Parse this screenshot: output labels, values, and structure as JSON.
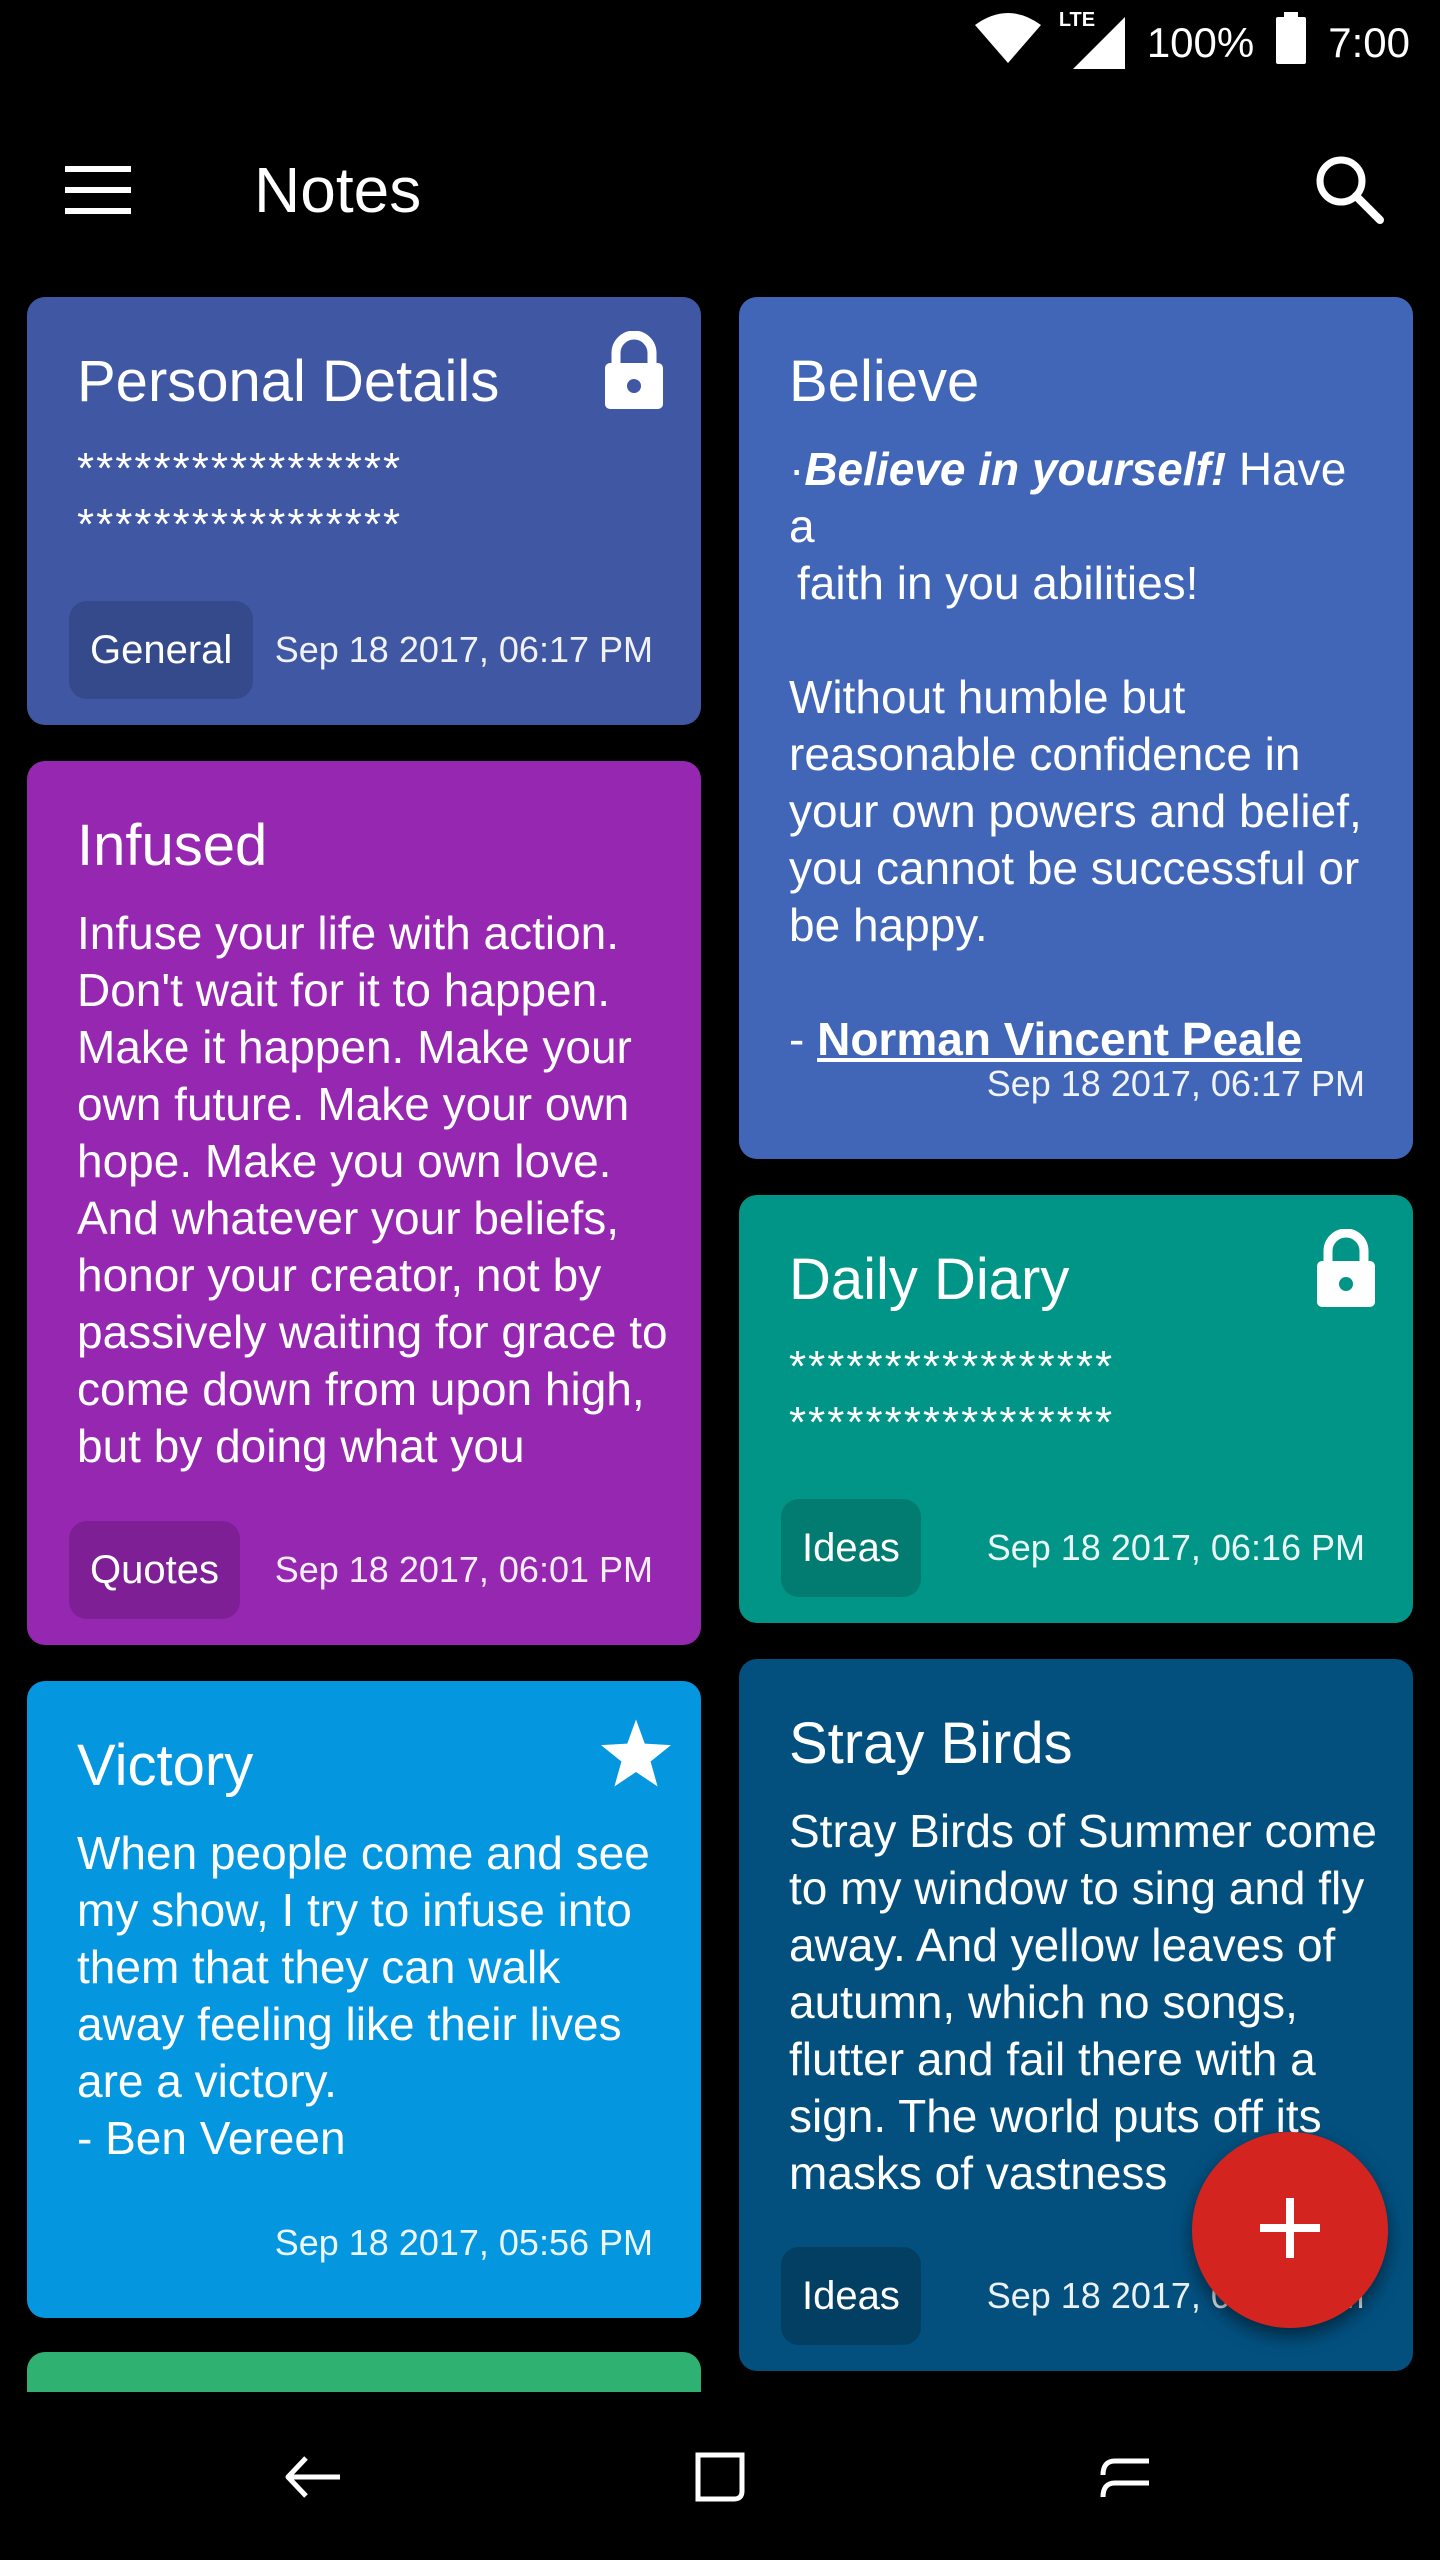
{
  "status_bar": {
    "network": "LTE",
    "battery": "100%",
    "time": "7:00"
  },
  "app_bar": {
    "title": "Notes",
    "menu_icon": "hamburger-menu-icon",
    "search_icon": "search-icon"
  },
  "notes": [
    {
      "title": "Personal Details",
      "body_masked": [
        "*****************",
        "*****************"
      ],
      "chip": "General",
      "timestamp": "Sep 18 2017, 06:17 PM",
      "icon": "lock-icon",
      "color": "#4058A4",
      "chip_color": "#344A8B"
    },
    {
      "title": "Infused",
      "body": "Infuse your life with action. Don't wait for it to happen. Make it happen. Make your own future. Make your own hope. Make you own love. And whatever your beliefs, honor your creator, not by passively waiting for grace to come down from upon high, but by doing what you",
      "chip": "Quotes",
      "timestamp": "Sep 18 2017, 06:01 PM",
      "color": "#9527B0",
      "chip_color": "#7E1F96"
    },
    {
      "title": "Victory",
      "body": "When people come and see my show, I try to infuse into them that they can walk away feeling like their lives are a victory.",
      "body_author": "- Ben Vereen",
      "timestamp": "Sep 18 2017, 05:56 PM",
      "icon": "star-icon",
      "color": "#0496DF"
    },
    {
      "title": "Believe",
      "bold_italic": "Believe in yourself!",
      "after_bold": " Have a",
      "line2": "faith in you abilities!",
      "para2": "Without humble but reasonable confidence in your own powers and belief, you cannot be successful or be happy.",
      "author_prefix": "- ",
      "author": "Norman Vincent Peale",
      "timestamp": "Sep 18 2017, 06:17 PM",
      "color": "#4166B8"
    },
    {
      "title": "Daily Diary",
      "body_masked": [
        "*****************",
        "*****************"
      ],
      "chip": "Ideas",
      "timestamp": "Sep 18 2017, 06:16 PM",
      "icon": "lock-icon",
      "color": "#009587",
      "chip_color": "#027C70"
    },
    {
      "title": "Stray Birds",
      "body": "Stray Birds of Summer come to my window to sing and fly away. And yellow leaves of autumn, which no songs, flutter and fail there with a sign. The world puts off its masks of vastness",
      "chip": "Ideas",
      "timestamp": "Sep 18 2017, 06:12 PM",
      "color": "#03507F",
      "chip_color": "#033F63"
    }
  ],
  "peek_card_color": "#2FB271",
  "fab": {
    "icon": "add-icon",
    "color": "#D32420"
  },
  "nav_bar": {
    "back_icon": "back-icon",
    "home_icon": "home-icon",
    "recents_icon": "recents-icon"
  }
}
